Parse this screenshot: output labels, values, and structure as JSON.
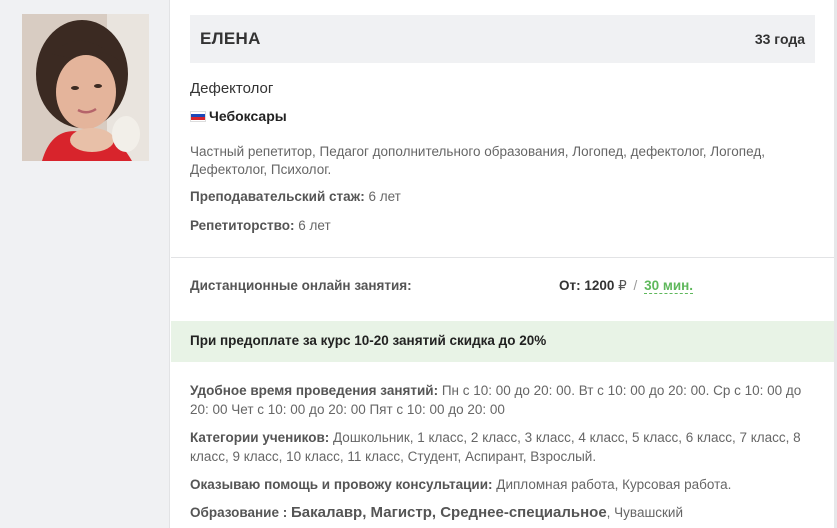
{
  "tutor": {
    "name": "ЕЛЕНА",
    "age": "33 года",
    "profession": "Дефектолог",
    "city": "Чебоксары",
    "specializations": "Частный репетитор, Педагог дополнительного образования, Логопед, дефектолог, Логопед, Дефектолог, Психолог.",
    "teaching_label": "Преподавательский стаж:",
    "teaching_value": "6 лет",
    "tutoring_label": "Репетиторство:",
    "tutoring_value": "6 лет"
  },
  "lessons": {
    "online_label": "Дистанционные онлайн занятия:",
    "price_prefix": "От: 1200",
    "currency": "₽",
    "separator": "/",
    "duration": "30 мин."
  },
  "promo": {
    "text": "При предоплате за курс 10-20 занятий скидка до 20%"
  },
  "details": {
    "schedule_label": "Удобное время проведения занятий:",
    "schedule_value": "Пн с 10: 00 до 20: 00. Вт с 10: 00 до 20: 00. Ср с 10: 00 до 20: 00 Чет с 10: 00 до 20: 00 Пят с 10: 00 до 20: 00",
    "categories_label": "Категории учеников:",
    "categories_value": "Дошкольник, 1 класс, 2 класс, 3 класс, 4 класс, 5 класс, 6 класс, 7 класс, 8 класс, 9 класс, 10 класс, 11 класс, Студент, Аспирант, Взрослый.",
    "help_label": "Оказываю помощь и провожу консультации:",
    "help_value": "Дипломная работа, Курсовая работа.",
    "education_label": "Образование :",
    "education_levels": "Бакалавр, Магистр, Среднее-специальное",
    "education_rest": ", Чувашский"
  },
  "colors": {
    "accent_green": "#5fb85c",
    "promo_bg": "#e8f3e6",
    "panel_bg": "#f0f1f3"
  }
}
